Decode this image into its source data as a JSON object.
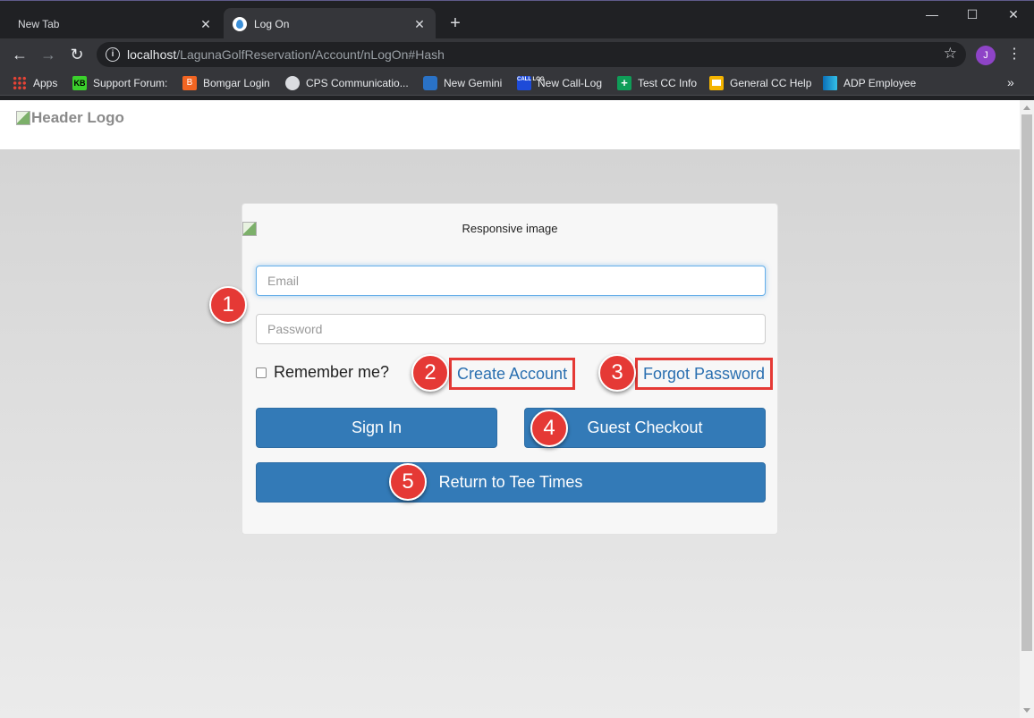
{
  "browser": {
    "tabs": [
      {
        "title": "New Tab",
        "active": false
      },
      {
        "title": "Log On",
        "active": true
      }
    ],
    "url_host": "localhost",
    "url_path": "/LagunaGolfReservation/Account/nLogOn#Hash",
    "profile_initial": "J",
    "bookmarks": [
      {
        "label": "Apps",
        "icon": "apps-grid-icon"
      },
      {
        "label": "Support Forum:",
        "icon": "kb-icon",
        "icon_text": "KB"
      },
      {
        "label": "Bomgar Login",
        "icon": "bomgar-icon",
        "icon_text": "B"
      },
      {
        "label": "CPS Communicatio...",
        "icon": "globe-icon"
      },
      {
        "label": "New Gemini",
        "icon": "gemini-icon"
      },
      {
        "label": "New Call-Log",
        "icon": "call-log-icon",
        "icon_text": "CALL LOG"
      },
      {
        "label": "Test CC Info",
        "icon": "cross-icon",
        "icon_text": "+"
      },
      {
        "label": "General CC Help",
        "icon": "slides-icon"
      },
      {
        "label": "ADP Employee",
        "icon": "adp-icon"
      }
    ]
  },
  "page": {
    "header_logo_alt": "Header Logo",
    "responsive_image_alt": "Responsive image",
    "email_placeholder": "Email",
    "password_placeholder": "Password",
    "remember_label": "Remember me?",
    "create_account": "Create Account",
    "forgot_password": "Forgot Password",
    "sign_in": "Sign In",
    "guest_checkout": "Guest Checkout",
    "return_tee_times": "Return to Tee Times"
  },
  "annotations": [
    "1",
    "2",
    "3",
    "4",
    "5"
  ],
  "colors": {
    "button": "#337ab7",
    "annotation_red": "#e53935",
    "link": "#2a6fb0"
  }
}
